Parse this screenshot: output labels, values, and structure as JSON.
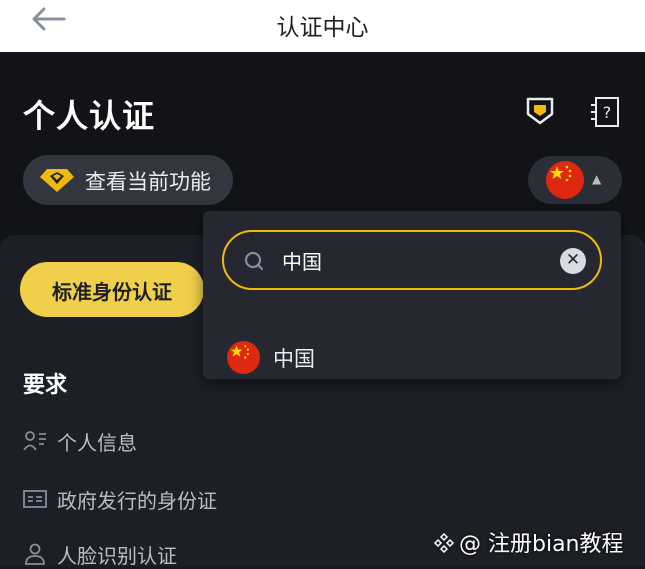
{
  "header": {
    "title": "认证中心",
    "back_icon": "arrow-left-icon"
  },
  "page": {
    "heading": "个人认证",
    "feature_button": "查看当前功能",
    "selected_country_flag": "china-flag-icon",
    "standard_verification_button": "标准身份认证",
    "requirements_title": "要求",
    "requirements": [
      {
        "label": "个人信息",
        "icon": "person-info-icon"
      },
      {
        "label": "政府发行的身份证",
        "icon": "id-card-icon"
      },
      {
        "label": "人脸识别认证",
        "icon": "person-icon"
      }
    ]
  },
  "country_dropdown": {
    "search_value": "中国",
    "options": [
      {
        "label": "中国",
        "flag": "china-flag-icon"
      }
    ]
  },
  "watermark": "@ 注册bian教程",
  "colors": {
    "accent": "#f0b90b",
    "button_yellow": "#f0cf4b",
    "flag_red": "#de2910",
    "flag_star": "#ffde00"
  }
}
